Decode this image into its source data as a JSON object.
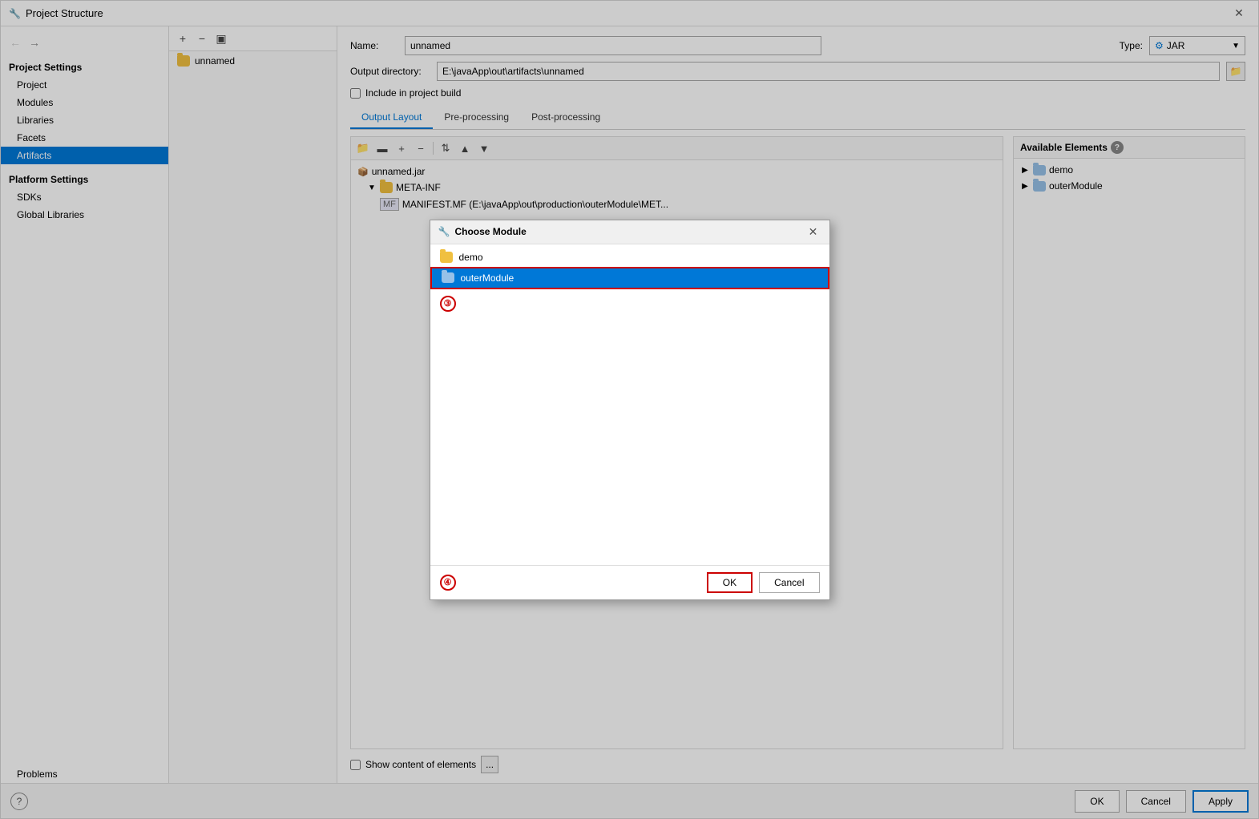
{
  "window": {
    "title": "Project Structure",
    "icon": "🔧"
  },
  "sidebar": {
    "project_settings_title": "Project Settings",
    "items": [
      {
        "label": "Project",
        "active": false
      },
      {
        "label": "Modules",
        "active": false
      },
      {
        "label": "Libraries",
        "active": false
      },
      {
        "label": "Facets",
        "active": false
      },
      {
        "label": "Artifacts",
        "active": true
      }
    ],
    "platform_settings_title": "Platform Settings",
    "platform_items": [
      {
        "label": "SDKs",
        "active": false
      },
      {
        "label": "Global Libraries",
        "active": false
      }
    ],
    "problems_label": "Problems"
  },
  "artifact_panel": {
    "artifact_name": "unnamed"
  },
  "main": {
    "name_label": "Name:",
    "name_value": "unnamed",
    "type_label": "Type:",
    "type_value": "JAR",
    "output_dir_label": "Output directory:",
    "output_dir_value": "E:\\javaApp\\out\\artifacts\\unnamed",
    "include_checkbox_label": "Include in project build",
    "tabs": [
      {
        "label": "Output Layout",
        "active": true
      },
      {
        "label": "Pre-processing",
        "active": false
      },
      {
        "label": "Post-processing",
        "active": false
      }
    ],
    "output_tree": {
      "items": [
        {
          "label": "unnamed.jar",
          "type": "jar",
          "level": 0
        },
        {
          "label": "META-INF",
          "type": "folder",
          "level": 1,
          "expanded": true
        },
        {
          "label": "MANIFEST.MF (E:\\javaApp\\out\\production\\outerModule\\MET...",
          "type": "manifest",
          "level": 2
        }
      ]
    },
    "available_elements": {
      "title": "Available Elements",
      "items": [
        {
          "label": "demo",
          "type": "module-folder",
          "level": 0,
          "arrow": "▶"
        },
        {
          "label": "outerModule",
          "type": "module-folder",
          "level": 0,
          "arrow": "▶"
        }
      ]
    },
    "show_content_label": "Show content of elements",
    "dots_btn_label": "..."
  },
  "footer": {
    "ok_label": "OK",
    "cancel_label": "Cancel",
    "apply_label": "Apply"
  },
  "dialog": {
    "title": "Choose Module",
    "icon": "🔧",
    "items": [
      {
        "label": "demo",
        "type": "folder",
        "selected": false
      },
      {
        "label": "outerModule",
        "type": "module-folder",
        "selected": true
      }
    ],
    "annotation_3": "③",
    "annotation_4": "④",
    "ok_label": "OK",
    "cancel_label": "Cancel"
  }
}
